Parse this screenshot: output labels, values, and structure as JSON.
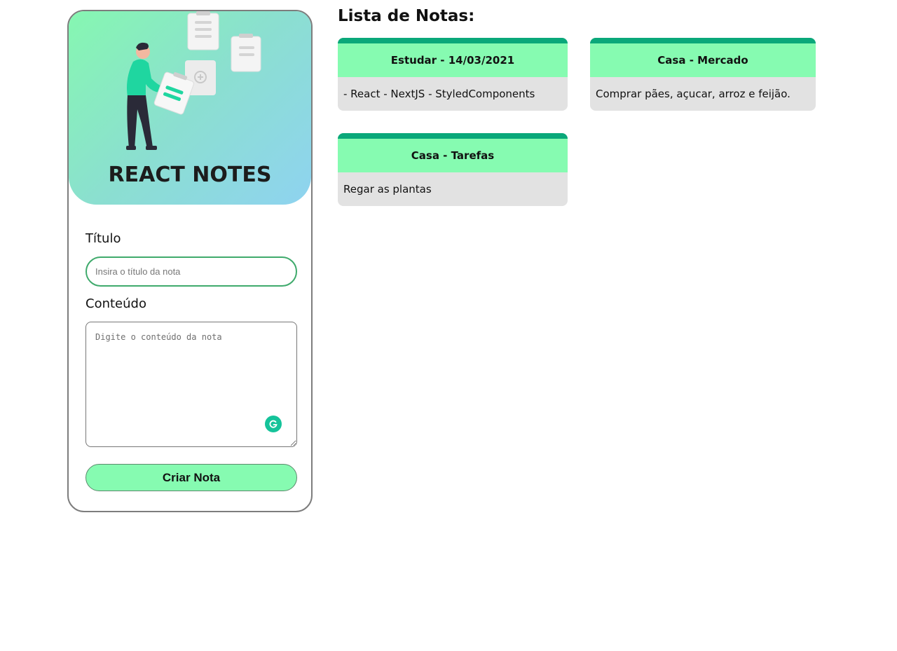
{
  "app": {
    "title": "REACT NOTES"
  },
  "form": {
    "title_label": "Título",
    "title_placeholder": "Insira o título da nota",
    "title_value": "",
    "content_label": "Conteúdo",
    "content_placeholder": "Digite o conteúdo da nota",
    "content_value": "",
    "submit_label": "Criar Nota"
  },
  "list": {
    "heading": "Lista de Notas:",
    "notes": [
      {
        "title": "Estudar - 14/03/2021",
        "content": "- React - NextJS - StyledComponents"
      },
      {
        "title": "Casa - Mercado",
        "content": "Comprar pães, açucar, arroz e feijão."
      },
      {
        "title": "Casa - Tarefas",
        "content": "Regar as plantas"
      }
    ]
  },
  "colors": {
    "accent": "#86fbb1",
    "note_bar": "#0aa87a",
    "note_body": "#e2e2e2",
    "input_border": "#3faa6c",
    "grammarly": "#15c39a"
  },
  "icons": {
    "hero": "person-with-notes-illustration",
    "grammarly": "grammarly-icon"
  }
}
